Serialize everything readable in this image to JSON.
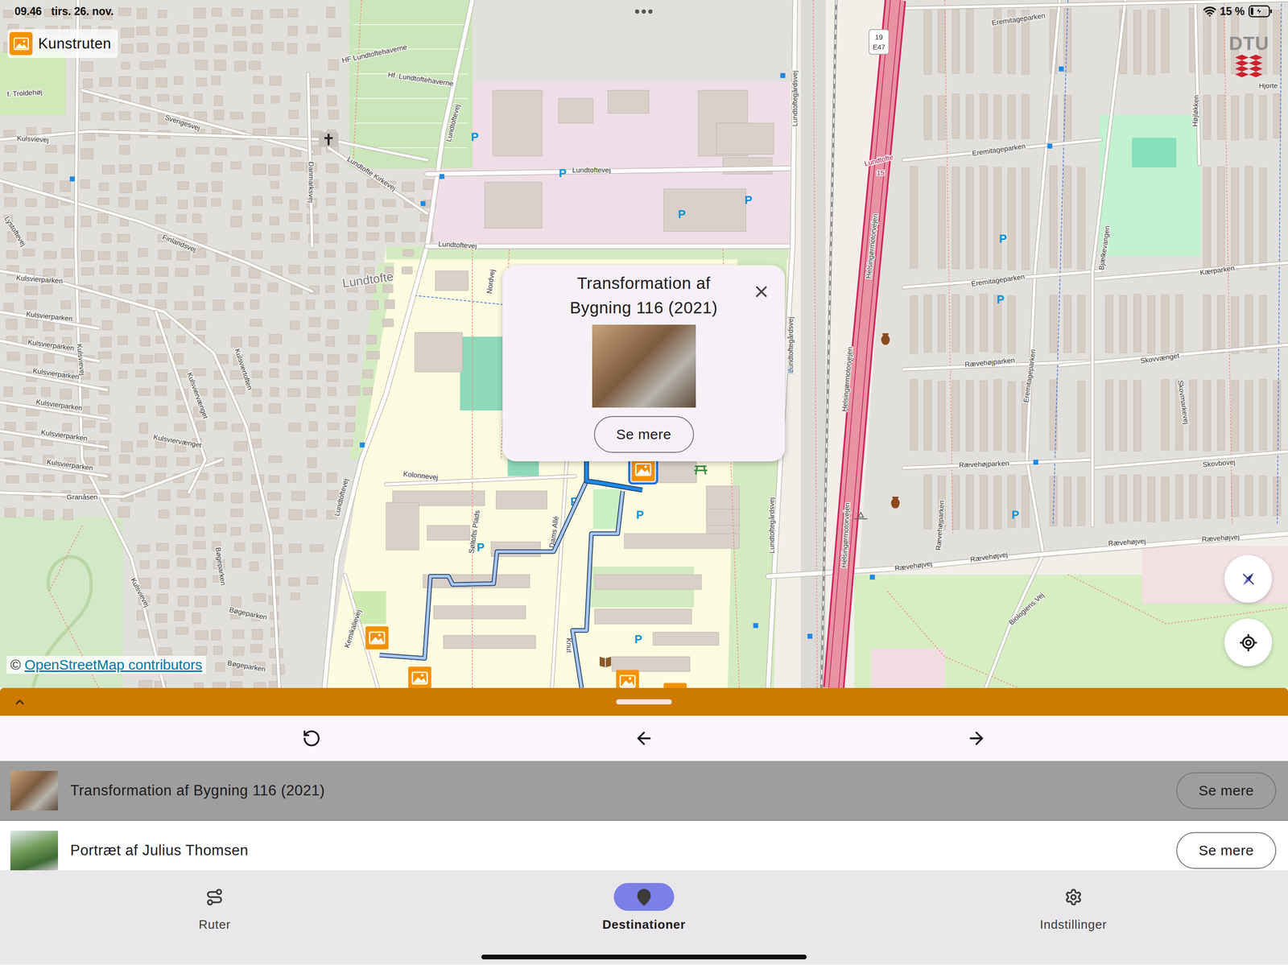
{
  "status_bar": {
    "time": "09.46",
    "date": "tirs. 26. nov.",
    "battery": "15 %",
    "battery_level": 0.15,
    "charging": true
  },
  "app_title": "Kunstruten",
  "logo": "DTU",
  "map": {
    "labels": [
      {
        "text": "Sverigesvej",
        "kind": "street"
      },
      {
        "text": "Kulsvievej",
        "kind": "street"
      },
      {
        "text": "Danmarksvej",
        "kind": "street"
      },
      {
        "text": "Lundtofte Kirkevej",
        "kind": "street"
      },
      {
        "text": "HF Lundtoftehaverne",
        "kind": "street"
      },
      {
        "text": "Hf. Lundtoftehaverne",
        "kind": "street"
      },
      {
        "text": "Lundtoftevej",
        "kind": "street"
      },
      {
        "text": "Lundtoftevej",
        "kind": "street"
      },
      {
        "text": "Lundtoftevej",
        "kind": "street"
      },
      {
        "text": "Lundtoftevej",
        "kind": "street"
      },
      {
        "text": "Finlandsvej",
        "kind": "street"
      },
      {
        "text": "Lystoftevej",
        "kind": "street"
      },
      {
        "text": "Lundtofte",
        "kind": "place"
      },
      {
        "text": "Kulsvierparken",
        "kind": "street"
      },
      {
        "text": "Kulsvierparken",
        "kind": "street"
      },
      {
        "text": "Kulsvierparken",
        "kind": "street"
      },
      {
        "text": "Kulsvierparken",
        "kind": "street"
      },
      {
        "text": "Kulsvierparken",
        "kind": "street"
      },
      {
        "text": "Kulsvierparken",
        "kind": "street"
      },
      {
        "text": "Kulsvierparken",
        "kind": "street"
      },
      {
        "text": "Kulsvievej",
        "kind": "street"
      },
      {
        "text": "Kulsviertoften",
        "kind": "street"
      },
      {
        "text": "Kulsviervænget",
        "kind": "street"
      },
      {
        "text": "Kulsviervænget",
        "kind": "street"
      },
      {
        "text": "Granåsen",
        "kind": "street"
      },
      {
        "text": "Kulsvievej",
        "kind": "street"
      },
      {
        "text": "Bøgeparken",
        "kind": "street"
      },
      {
        "text": "Bøgeparken",
        "kind": "street"
      },
      {
        "text": "Bøgeparken",
        "kind": "street"
      },
      {
        "text": "Kemikalievej",
        "kind": "street"
      },
      {
        "text": "f. Troldehøj",
        "kind": "street"
      },
      {
        "text": "Nordvej",
        "kind": "street"
      },
      {
        "text": "Kolonnevej",
        "kind": "street"
      },
      {
        "text": "Søltofts Plads",
        "kind": "street"
      },
      {
        "text": "Dams Allé",
        "kind": "street"
      },
      {
        "text": "Lundtoftegårdsvej",
        "kind": "street"
      },
      {
        "text": "Lundtoftegårdsvej",
        "kind": "street"
      },
      {
        "text": "Lundtoftegårdsvej",
        "kind": "street"
      },
      {
        "text": "Helsingørmotorvejen",
        "kind": "street"
      },
      {
        "text": "Helsingørmotorvejen",
        "kind": "street"
      },
      {
        "text": "Helsingørmotorvejen",
        "kind": "street"
      },
      {
        "text": "Lundtofte",
        "kind": "station"
      },
      {
        "text": "15",
        "kind": "station"
      },
      {
        "text": "Eremitageparken",
        "kind": "street"
      },
      {
        "text": "Eremitageparken",
        "kind": "street"
      },
      {
        "text": "Eremitageparken",
        "kind": "street"
      },
      {
        "text": "Eremitageparken",
        "kind": "street"
      },
      {
        "text": "Rævehøjparken",
        "kind": "street"
      },
      {
        "text": "Rævehøjparken",
        "kind": "street"
      },
      {
        "text": "Rævehøjparken",
        "kind": "street"
      },
      {
        "text": "Rævehøjvej",
        "kind": "street"
      },
      {
        "text": "Rævehøjvej",
        "kind": "street"
      },
      {
        "text": "Rævehøjvej",
        "kind": "street"
      },
      {
        "text": "Rævehøjvej",
        "kind": "street"
      },
      {
        "text": "Kærparken",
        "kind": "street"
      },
      {
        "text": "Skovvænget",
        "kind": "street"
      },
      {
        "text": "Skovbovej",
        "kind": "street"
      },
      {
        "text": "Skovmarkevej",
        "kind": "street"
      },
      {
        "text": "Højløkken",
        "kind": "street"
      },
      {
        "text": "Bjælkevangen",
        "kind": "street"
      },
      {
        "text": "Biologiens Vej",
        "kind": "street"
      },
      {
        "text": "Hjorte",
        "kind": "street"
      },
      {
        "text": "Knut",
        "kind": "street"
      }
    ],
    "parking_symbol": "P",
    "road_shield": [
      "19",
      "E47"
    ],
    "attribution_symbol": "©",
    "attribution": "OpenStreetMap contributors",
    "pins": [
      {
        "selected": true
      },
      {
        "selected": false
      },
      {
        "selected": false
      },
      {
        "selected": false
      },
      {
        "selected": false
      }
    ]
  },
  "popup": {
    "title": "Transformation af Bygning 116 (2021)",
    "button": "Se mere"
  },
  "destinations": [
    {
      "title": "Transformation af Bygning 116 (2021)",
      "button": "Se mere",
      "selected": true
    },
    {
      "title": "Portræt af Julius Thomsen",
      "button": "Se mere",
      "selected": false
    }
  ],
  "nav": [
    {
      "label": "Ruter",
      "selected": false
    },
    {
      "label": "Destinationer",
      "selected": true
    },
    {
      "label": "Indstillinger",
      "selected": false
    }
  ]
}
